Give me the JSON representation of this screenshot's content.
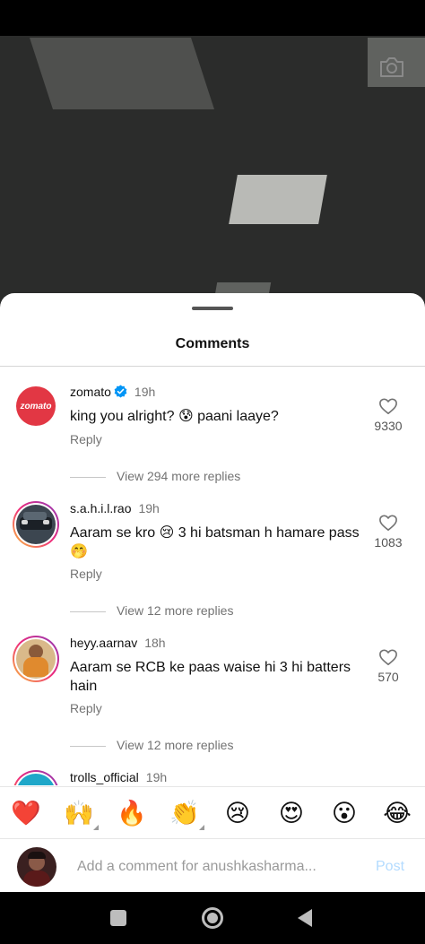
{
  "sheet": {
    "title": "Comments"
  },
  "comments": [
    {
      "username": "zomato",
      "verified": true,
      "time": "19h",
      "text": "king you alright? 😰 paani laaye?",
      "reply_label": "Reply",
      "likes": "9330",
      "view_more": "View 294 more replies",
      "avatar_text": "zomato"
    },
    {
      "username": "s.a.h.i.l.rao",
      "time": "19h",
      "text": "Aaram se kro 😢 3 hi batsman h hamare pass 🤭",
      "reply_label": "Reply",
      "likes": "1083",
      "view_more": "View 12 more replies"
    },
    {
      "username": "heyy.aarnav",
      "time": "18h",
      "text": "Aaram se RCB ke paas waise hi 3 hi batters hain",
      "reply_label": "Reply",
      "likes": "570",
      "view_more": "View 12 more replies"
    },
    {
      "username": "trolls_official",
      "time": "19h"
    }
  ],
  "reactions": [
    "❤️",
    "🙌",
    "🔥",
    "👏",
    "😢",
    "😍",
    "😮",
    "😂"
  ],
  "input": {
    "placeholder": "Add a comment for anushkasharma...",
    "post_label": "Post"
  },
  "colors": {
    "accent_blue": "#0095f6",
    "post_disabled": "#b3dbff",
    "zomato_red": "#e23744",
    "secondary_text": "#737373"
  }
}
